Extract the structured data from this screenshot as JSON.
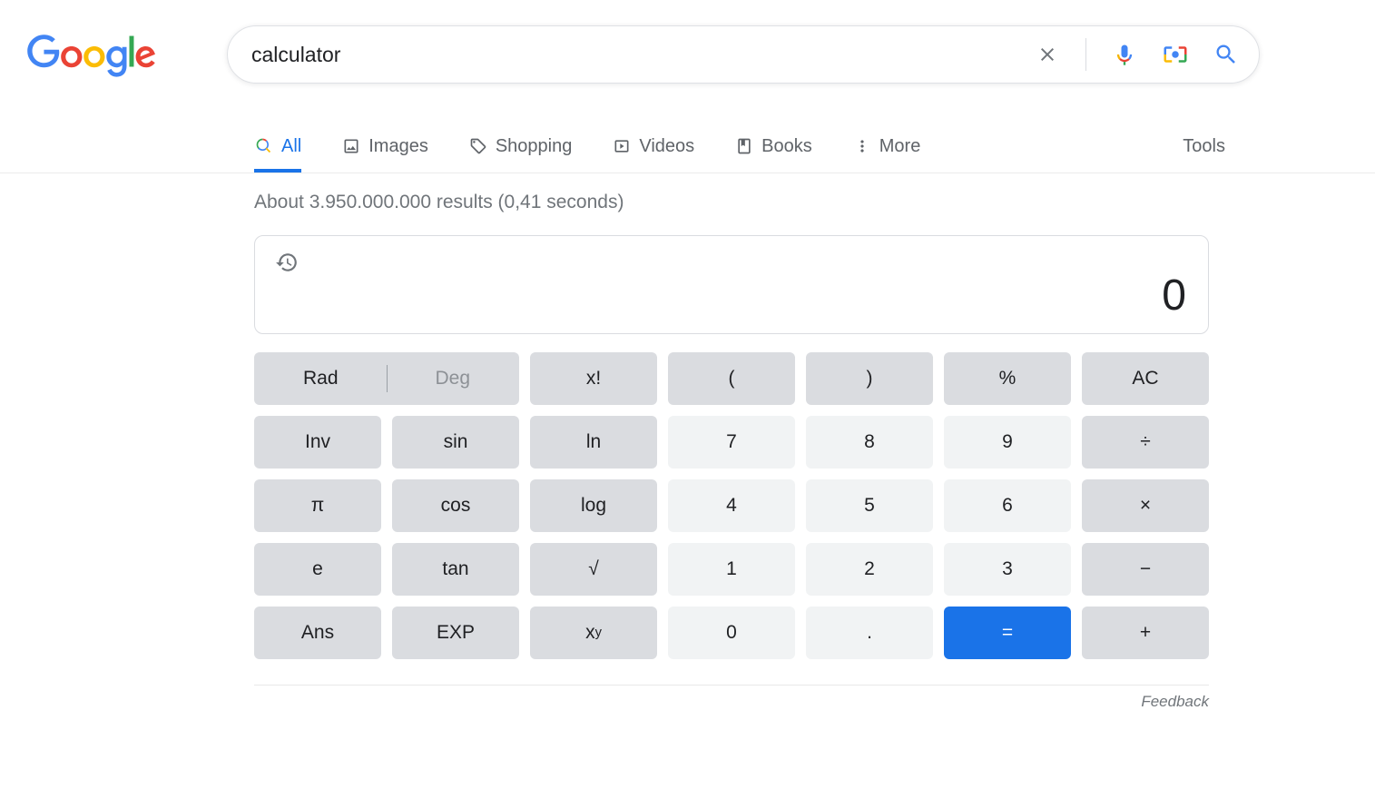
{
  "search": {
    "query": "calculator"
  },
  "tabs": {
    "all": "All",
    "images": "Images",
    "shopping": "Shopping",
    "videos": "Videos",
    "books": "Books",
    "more": "More",
    "tools": "Tools"
  },
  "stats": "About 3.950.000.000 results (0,41 seconds)",
  "calc": {
    "value": "0",
    "buttons": {
      "rad": "Rad",
      "deg": "Deg",
      "fact": "x!",
      "lparen": "(",
      "rparen": ")",
      "percent": "%",
      "ac": "AC",
      "inv": "Inv",
      "sin": "sin",
      "ln": "ln",
      "n7": "7",
      "n8": "8",
      "n9": "9",
      "div": "÷",
      "pi": "π",
      "cos": "cos",
      "log": "log",
      "n4": "4",
      "n5": "5",
      "n6": "6",
      "mul": "×",
      "e": "e",
      "tan": "tan",
      "sqrt": "√",
      "n1": "1",
      "n2": "2",
      "n3": "3",
      "sub": "−",
      "ans": "Ans",
      "exp": "EXP",
      "pow_base": "x",
      "pow_exp": "y",
      "n0": "0",
      "dot": ".",
      "eq": "=",
      "add": "+"
    }
  },
  "feedback": "Feedback"
}
